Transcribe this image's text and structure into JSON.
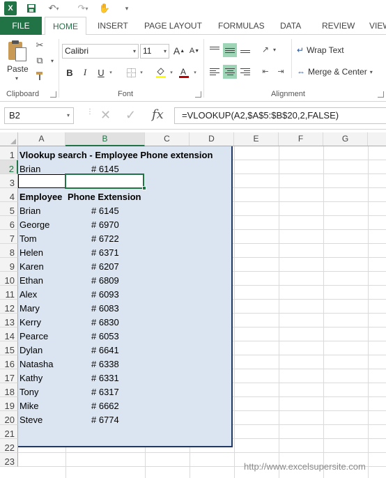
{
  "app": {
    "logo_text": "X"
  },
  "qat": {
    "save_icon": "save-icon",
    "undo_icon": "undo-icon",
    "redo_icon": "redo-icon",
    "touch_icon": "touch-mode-icon"
  },
  "tabs": [
    "FILE",
    "HOME",
    "INSERT",
    "PAGE LAYOUT",
    "FORMULAS",
    "DATA",
    "REVIEW",
    "VIEW"
  ],
  "ribbon": {
    "paste_label": "Paste",
    "clipboard_label": "Clipboard",
    "font_label": "Font",
    "alignment_label": "Alignment",
    "font_name": "Calibri",
    "font_size": "11",
    "grow_font": "A",
    "shrink_font": "A",
    "bold": "B",
    "italic": "I",
    "underline": "U",
    "wrap_text": "Wrap Text",
    "merge_center": "Merge & Center"
  },
  "formula_bar": {
    "name_box": "B2",
    "fx": "fx",
    "formula": "=VLOOKUP(A2,$A$5:$B$20,2,FALSE)"
  },
  "columns": [
    "A",
    "B",
    "C",
    "D",
    "E",
    "F",
    "G"
  ],
  "rows": [
    "1",
    "2",
    "3",
    "4",
    "5",
    "6",
    "7",
    "8",
    "9",
    "10",
    "11",
    "12",
    "13",
    "14",
    "15",
    "16",
    "17",
    "18",
    "19",
    "20",
    "21",
    "22",
    "23"
  ],
  "sheet": {
    "title": "Vlookup search - Employee Phone extension",
    "lookup_name": "Brian",
    "lookup_result": "# 6145",
    "header_employee": "Employee",
    "header_extension": "Phone Extension",
    "employees": [
      {
        "name": "Brian",
        "ext": "# 6145"
      },
      {
        "name": "George",
        "ext": "# 6970"
      },
      {
        "name": "Tom",
        "ext": "# 6722"
      },
      {
        "name": "Helen",
        "ext": "# 6371"
      },
      {
        "name": "Karen",
        "ext": "# 6207"
      },
      {
        "name": "Ethan",
        "ext": "# 6809"
      },
      {
        "name": "Alex",
        "ext": "# 6093"
      },
      {
        "name": "Mary",
        "ext": "# 6083"
      },
      {
        "name": "Kerry",
        "ext": "# 6830"
      },
      {
        "name": "Pearce",
        "ext": "# 6053"
      },
      {
        "name": "Dylan",
        "ext": "# 6641"
      },
      {
        "name": "Natasha",
        "ext": "# 6338"
      },
      {
        "name": "Kathy",
        "ext": "# 6331"
      },
      {
        "name": "Tony",
        "ext": "# 6317"
      },
      {
        "name": "Mike",
        "ext": "# 6662"
      },
      {
        "name": "Steve",
        "ext": "# 6774"
      }
    ]
  },
  "watermark": "http://www.excelsupersite.com",
  "colors": {
    "excel_green": "#217346",
    "range_fill": "#dbe5f1",
    "range_border": "#1f3864"
  }
}
